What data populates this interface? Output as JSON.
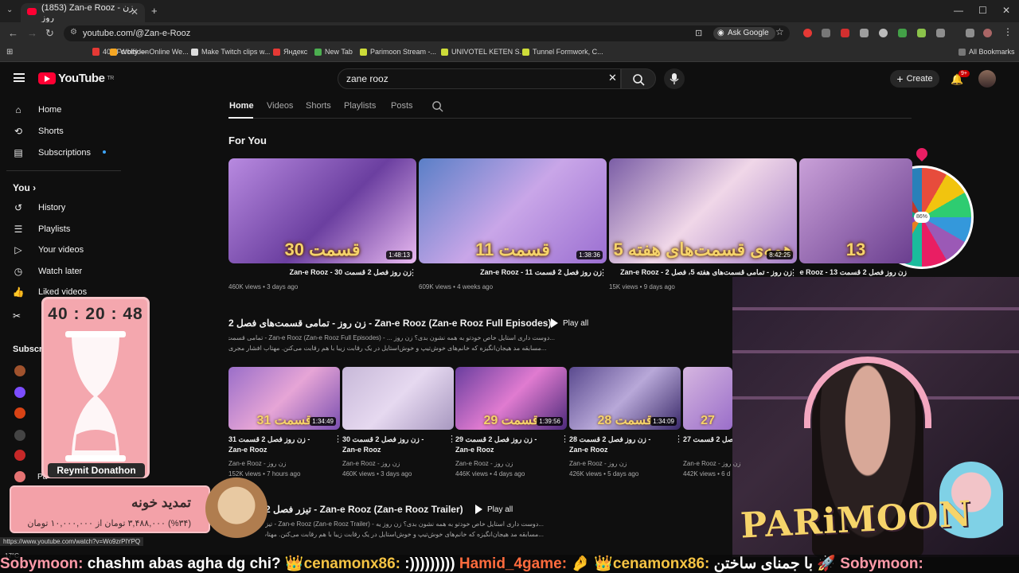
{
  "browser": {
    "tab_title": "(1853) Zan-e Rooz - زن روز",
    "url": "youtube.com/@Zan-e-Rooz",
    "ask_google": "Ask Google",
    "bookmarks": [
      "403 Forbidden",
      "Wolfy — Online We...",
      "Make Twitch clips w...",
      "Яндекс",
      "New Tab",
      "Parimoon Stream -...",
      "UNIVOTEL KETEN S...",
      "Tunnel Formwork, C..."
    ],
    "all_bookmarks": "All Bookmarks",
    "status_url": "https://www.youtube.com/watch?v=Wo9zrPlYPQ"
  },
  "header": {
    "logo": "YouTube",
    "logo_sup": "TR",
    "search_value": "zane rooz",
    "create_label": "Create",
    "notif_badge": "9+"
  },
  "sidebar": {
    "items": [
      {
        "label": "Home",
        "icon": "home-icon"
      },
      {
        "label": "Shorts",
        "icon": "shorts-icon"
      },
      {
        "label": "Subscriptions",
        "icon": "subscriptions-icon"
      }
    ],
    "you_heading": "You",
    "you_items": [
      {
        "label": "History",
        "icon": "history-icon"
      },
      {
        "label": "Playlists",
        "icon": "playlists-icon"
      },
      {
        "label": "Your videos",
        "icon": "your-videos-icon"
      },
      {
        "label": "Watch later",
        "icon": "watch-later-icon"
      },
      {
        "label": "Liked videos",
        "icon": "liked-icon"
      }
    ],
    "subs_heading": "Subscri",
    "subs_last": "Pa"
  },
  "channel_tabs": [
    "Home",
    "Videos",
    "Shorts",
    "Playlists",
    "Posts"
  ],
  "for_you": {
    "heading": "For You",
    "videos": [
      {
        "title": "زن روز فصل 2 قسمت 30 - Zan-e Rooz",
        "meta": "460K views • 3 days ago",
        "duration": "1:48:13",
        "overlay": "قسمت 30"
      },
      {
        "title": "زن روز فصل 2 قسمت 11 - Zan-e Rooz",
        "meta": "609K views • 4 weeks ago",
        "duration": "1:38:36",
        "overlay": "قسمت 11"
      },
      {
        "title": "زن روز - تمامی قسمت‌های هفته 5، فصل 2 - Zan-e Rooz",
        "meta": "15K views • 9 days ago",
        "duration": "8:42:25",
        "overlay": "همه‌ی قسمت‌های هفته 5"
      },
      {
        "title": "زن روز فصل 2 قسمت 13 - Zan-e Rooz",
        "meta": "",
        "duration": "",
        "overlay": "13"
      }
    ]
  },
  "playlist": {
    "title": "زن روز - تمامی قسمت‌های فصل 2 - Zan-e Rooz (Zan-e Rooz Full Episodes)",
    "play_all": "Play all",
    "desc1": "...دوست داری استایل خاص خودتو به همه نشون بدی؟ زن روز ... - Zan-e Rooz (Zan-e Rooz Full Episodes) - تمامی قسمت‌های فصل 2",
    "desc2": "...مسابقه مد هیجان‌انگیزه که خانم‌های خوش‌تیپ و خوش‌استایل در یک رقابت زیبا با هم رقابت می‌کنن. مهتاب افشار مجری",
    "videos": [
      {
        "title": "زن روز فصل 2 قسمت 31 - Zan-e Rooz",
        "channel": "Zan-e Rooz - زن روز",
        "meta": "152K views • 7 hours ago",
        "duration": "1:34:49",
        "overlay": "قسمت 31"
      },
      {
        "title": "زن روز فصل 2 قسمت 30 - Zan-e Rooz",
        "channel": "Zan-e Rooz - زن روز",
        "meta": "460K views • 3 days ago",
        "duration": "",
        "overlay": ""
      },
      {
        "title": "زن روز فصل 2 قسمت 29 - Zan-e Rooz",
        "channel": "Zan-e Rooz - زن روز",
        "meta": "446K views • 4 days ago",
        "duration": "1:39:56",
        "overlay": "قسمت 29"
      },
      {
        "title": "زن روز فصل 2 قسمت 28 - Zan-e Rooz",
        "channel": "Zan-e Rooz - زن روز",
        "meta": "426K views • 5 days ago",
        "duration": "1:34:09",
        "overlay": "قسمت 28"
      },
      {
        "title": "زن روز فصل 2 قسمت 27 - Zan-e Rooz",
        "channel": "Zan-e Rooz - زن روز",
        "meta": "442K views • 6 d",
        "duration": "",
        "overlay": "27"
      }
    ]
  },
  "trailer": {
    "title": "تیزر فصل 2 - Zan-e Rooz (Zan-e Rooz Trailer)",
    "play_all": "Play all",
    "desc1": "...دوست داری استایل خاص خودتو به همه نشون بدی؟ زن روز یه - Zan-e Rooz (Zan-e Rooz Trailer) - تیزر",
    "desc2": "...مسابقه مد هیجان‌انگیزه که خانم‌های خوش‌تیپ و خوش‌استایل در یک رقابت زیبا با هم رقابت می‌کنن. مهتاب افشار مجری"
  },
  "overlays": {
    "wheel_pct": "86%",
    "timer": "40 : 20 : 48",
    "donation_label": "Reymit Donathon",
    "promo_line1": "تمدید خونه",
    "promo_line2": "(%۳۴) ۳,۴۸۸,۰۰۰ تومان از ۱۰,۰۰۰,۰۰۰ تومان",
    "brand": "PARiMOON",
    "temperature": "17°C"
  },
  "chat": [
    {
      "user": "Sobymoon:",
      "text": " chashm abas agha dg chi? 👑"
    },
    {
      "user": "cenamonx86:",
      "text": " :))))))))) "
    },
    {
      "user": "Hamid_4game:",
      "text": " 🤌 👑"
    },
    {
      "user": "cenamonx86:",
      "text": " با جمنای ساختن 🚀 "
    },
    {
      "user": "Sobymoon:",
      "text": ""
    }
  ]
}
